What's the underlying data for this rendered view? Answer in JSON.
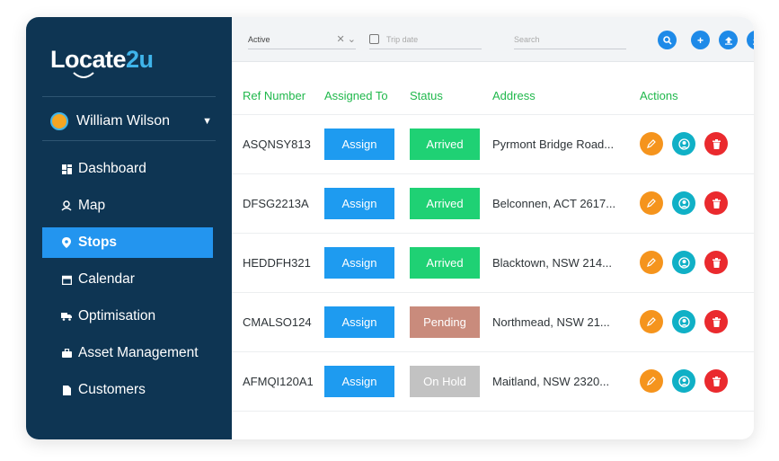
{
  "brand": {
    "logo_text_a": "Locate",
    "logo_text_b": "2u"
  },
  "user": {
    "name": "William Wilson"
  },
  "nav": [
    {
      "label": "Dashboard",
      "icon": "dashboard-icon",
      "active": false
    },
    {
      "label": "Map",
      "icon": "map-pin-person-icon",
      "active": false
    },
    {
      "label": "Stops",
      "icon": "location-pin-icon",
      "active": true
    },
    {
      "label": "Calendar",
      "icon": "calendar-icon",
      "active": false
    },
    {
      "label": "Optimisation",
      "icon": "truck-icon",
      "active": false
    },
    {
      "label": "Asset Management",
      "icon": "briefcase-icon",
      "active": false
    },
    {
      "label": "Customers",
      "icon": "document-icon",
      "active": false
    }
  ],
  "toolbar": {
    "status_value": "Active",
    "date_placeholder": "Trip date",
    "search_placeholder": "Search",
    "buttons": [
      "search-icon",
      "add-icon",
      "upload-icon",
      "download-icon"
    ]
  },
  "table": {
    "headers": [
      "Ref Number",
      "Assigned To",
      "Status",
      "Address",
      "Actions"
    ],
    "assign_label": "Assign",
    "rows": [
      {
        "ref": "ASQNSY813",
        "status": "Arrived",
        "status_color": "#1fd174",
        "address": "Pyrmont Bridge Road..."
      },
      {
        "ref": "DFSG2213A",
        "status": "Arrived",
        "status_color": "#1fd174",
        "address": "Belconnen, ACT 2617..."
      },
      {
        "ref": "HEDDFH321",
        "status": "Arrived",
        "status_color": "#1fd174",
        "address": "Blacktown, NSW 214..."
      },
      {
        "ref": "CMALSO124",
        "status": "Pending",
        "status_color": "#c98b7c",
        "address": "Northmead, NSW 21..."
      },
      {
        "ref": "AFMQI120A1",
        "status": "On Hold",
        "status_color": "#c2c2c2",
        "address": "Maitland, NSW 2320..."
      }
    ]
  },
  "colors": {
    "sidebar": "#0e3553",
    "active_nav": "#2395ef",
    "header_text": "#20b84c",
    "assign": "#1e9bf0"
  }
}
